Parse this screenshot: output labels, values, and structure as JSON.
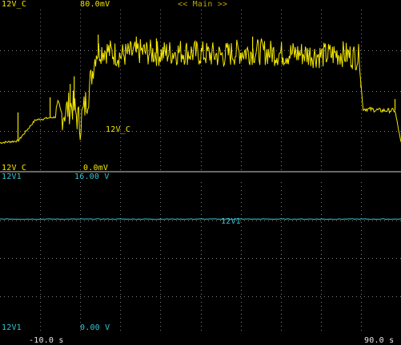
{
  "colors": {
    "background": "#000000",
    "ch1": "#f2e600",
    "ch2": "#32c8d6",
    "grid": "#7a7a7a",
    "divider": "#cfcfcf",
    "text": "#e8e8e8",
    "mode": "#b9a400"
  },
  "top_pane": {
    "channel_label": "12V_C",
    "top_value": "80.0mV",
    "bottom_value": "0.0mV",
    "mode_label": "<< Main >>",
    "trace_label": "12V_C"
  },
  "bottom_pane": {
    "channel_label": "12V1",
    "top_value": "16.00 V",
    "bottom_value": "0.00 V",
    "trace_label": "12V1"
  },
  "time_axis": {
    "start": "-10.0 s",
    "end": "90.0 s",
    "start_value": -10,
    "end_value": 90
  },
  "chart_data": [
    {
      "type": "line",
      "title": "",
      "series": [
        {
          "name": "12V_C"
        }
      ],
      "x_unit": "s",
      "y_unit": "mV",
      "xlim": [
        -10,
        90
      ],
      "ylim": [
        0,
        80
      ],
      "points": [
        [
          -10,
          14
        ],
        [
          -5.5,
          15
        ],
        [
          -1.2,
          26
        ],
        [
          2,
          27
        ],
        [
          5,
          28
        ],
        [
          8,
          34
        ],
        [
          10,
          24
        ],
        [
          12,
          40
        ],
        [
          14,
          62
        ],
        [
          16,
          63
        ],
        [
          20,
          60
        ],
        [
          25,
          62
        ],
        [
          30,
          61
        ],
        [
          35,
          62
        ],
        [
          40,
          61
        ],
        [
          45,
          60
        ],
        [
          50,
          62
        ],
        [
          55,
          62
        ],
        [
          60,
          61
        ],
        [
          65,
          61
        ],
        [
          70,
          60
        ],
        [
          75,
          61
        ],
        [
          79.5,
          59
        ],
        [
          80.5,
          32
        ],
        [
          85,
          31
        ],
        [
          88.5,
          31
        ],
        [
          90,
          14
        ]
      ],
      "spikes": [
        [
          -5.5,
          30
        ],
        [
          2.5,
          38
        ],
        [
          7.5,
          45
        ],
        [
          8.5,
          49
        ],
        [
          14.5,
          71
        ],
        [
          24,
          70
        ],
        [
          29,
          69
        ],
        [
          53,
          70
        ],
        [
          80,
          43
        ],
        [
          88.5,
          37
        ]
      ]
    },
    {
      "type": "line",
      "title": "",
      "series": [
        {
          "name": "12V1"
        }
      ],
      "x_unit": "s",
      "y_unit": "V",
      "xlim": [
        -10,
        90
      ],
      "ylim": [
        0,
        16
      ],
      "points": [
        [
          -10,
          12.1
        ],
        [
          90,
          12.1
        ]
      ]
    }
  ]
}
